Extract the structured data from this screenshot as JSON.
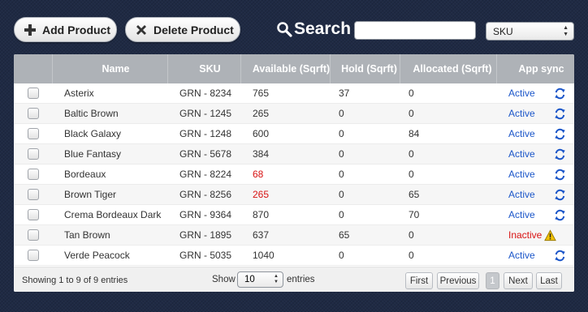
{
  "toolbar": {
    "add_label": "Add Product",
    "delete_label": "Delete Product",
    "search_label": "Search",
    "search_value": "",
    "search_placeholder": "",
    "filter_selected": "SKU"
  },
  "table": {
    "columns": [
      "",
      "Name",
      "SKU",
      "Available (Sqrft)",
      "Hold (Sqrft)",
      "Allocated (Sqrft)",
      "App sync"
    ],
    "rows": [
      {
        "name": "Asterix",
        "sku": "GRN - 8234",
        "available": "765",
        "hold": "37",
        "allocated": "0",
        "status": "Active"
      },
      {
        "name": "Baltic Brown",
        "sku": "GRN - 1245",
        "available": "265",
        "hold": "0",
        "allocated": "0",
        "status": "Active"
      },
      {
        "name": "Black Galaxy",
        "sku": "GRN - 1248",
        "available": "600",
        "hold": "0",
        "allocated": "84",
        "status": "Active"
      },
      {
        "name": "Blue Fantasy",
        "sku": "GRN - 5678",
        "available": "384",
        "hold": "0",
        "allocated": "0",
        "status": "Active"
      },
      {
        "name": "Bordeaux",
        "sku": "GRN - 8224",
        "available": "68",
        "hold": "0",
        "allocated": "0",
        "status": "Active"
      },
      {
        "name": "Brown Tiger",
        "sku": "GRN - 8256",
        "available": "265",
        "hold": "0",
        "allocated": "65",
        "status": "Active"
      },
      {
        "name": "Crema Bordeaux Dark",
        "sku": "GRN - 9364",
        "available": "870",
        "hold": "0",
        "allocated": "70",
        "status": "Active"
      },
      {
        "name": "Tan Brown",
        "sku": "GRN - 1895",
        "available": "637",
        "hold": "65",
        "allocated": "0",
        "status": "Inactive"
      },
      {
        "name": "Verde Peacock",
        "sku": "GRN - 5035",
        "available": "1040",
        "hold": "0",
        "allocated": "0",
        "status": "Active"
      }
    ]
  },
  "footer": {
    "info": "Showing 1 to 9 of 9 entries",
    "show_label": "Show",
    "page_length": "10",
    "entries_label": "entries",
    "first": "First",
    "previous": "Previous",
    "current_page": "1",
    "next": "Next",
    "last": "Last"
  },
  "colors": {
    "background": "#1f2a44",
    "header": "#aeb2b7",
    "active": "#1b56c9",
    "inactive_or_low": "#d81212",
    "warning": "#f2c200"
  },
  "icons": {
    "add": "plus-icon",
    "delete": "x-icon",
    "search": "magnifier-icon",
    "sync": "sync-icon",
    "warning": "warning-icon"
  },
  "low_stock_rows": [
    4,
    5
  ]
}
